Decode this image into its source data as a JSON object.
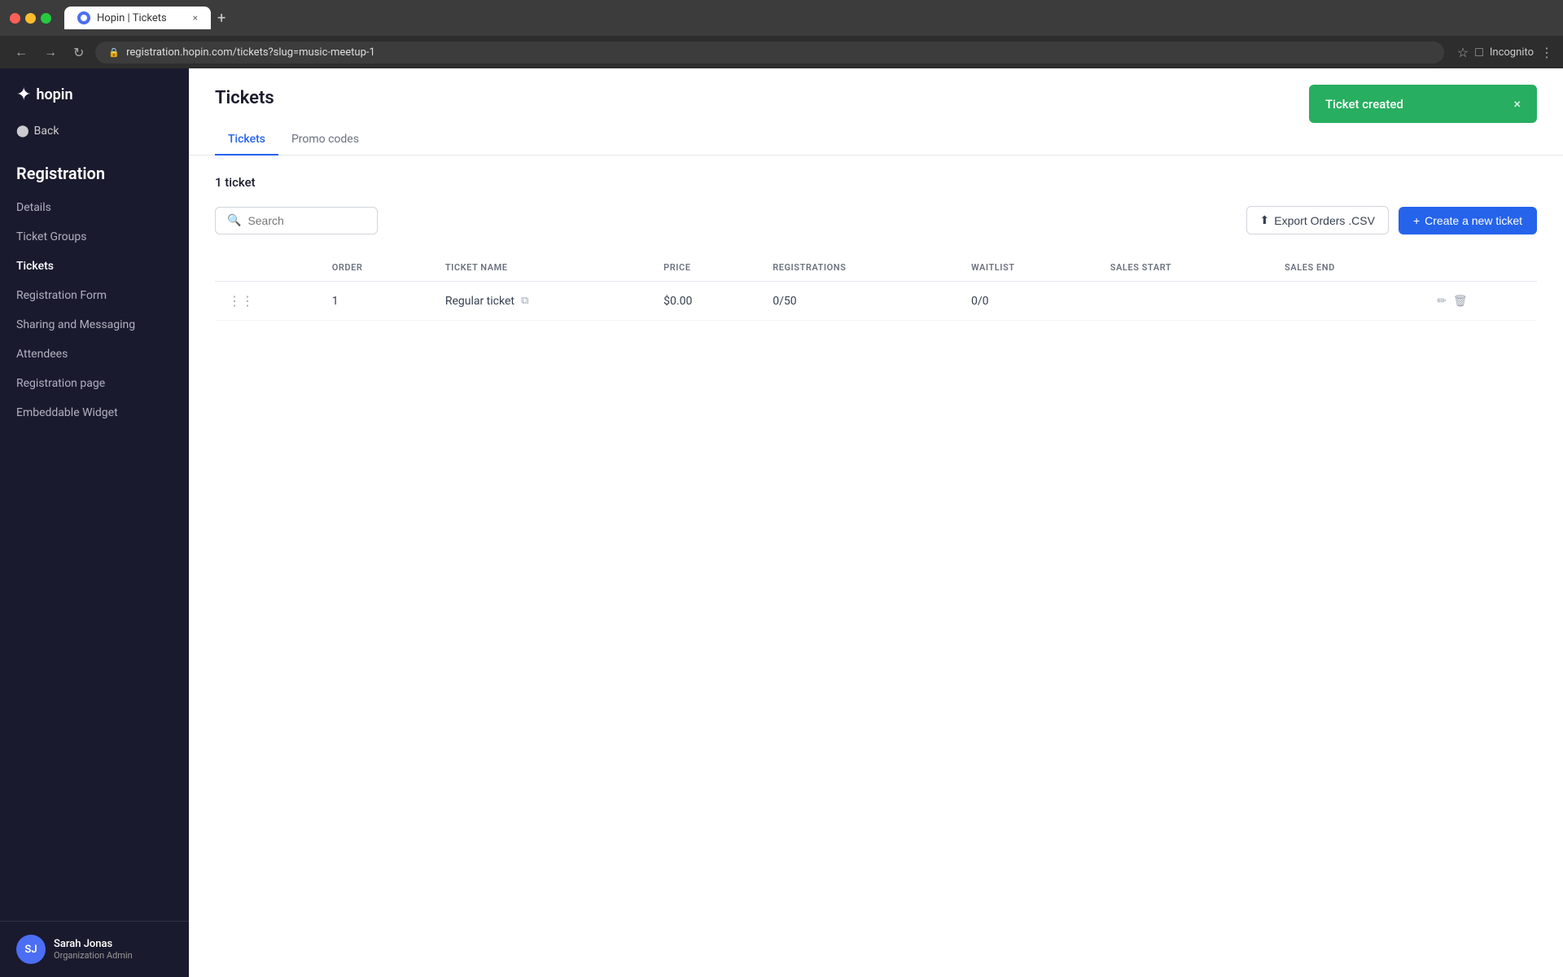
{
  "browser": {
    "tab_title": "Hopin | Tickets",
    "url": "registration.hopin.com/tickets?slug=music-meetup-1",
    "new_tab_label": "+",
    "back_label": "←",
    "forward_label": "→",
    "refresh_label": "↻",
    "profile_label": "Incognito"
  },
  "sidebar": {
    "logo_text": "hopin",
    "back_label": "Back",
    "section_title": "Registration",
    "nav_items": [
      {
        "id": "details",
        "label": "Details"
      },
      {
        "id": "ticket-groups",
        "label": "Ticket Groups"
      },
      {
        "id": "tickets",
        "label": "Tickets",
        "active": true
      },
      {
        "id": "registration-form",
        "label": "Registration Form"
      },
      {
        "id": "sharing-messaging",
        "label": "Sharing and Messaging"
      },
      {
        "id": "attendees",
        "label": "Attendees"
      },
      {
        "id": "registration-page",
        "label": "Registration page"
      },
      {
        "id": "embeddable-widget",
        "label": "Embeddable Widget"
      }
    ],
    "user": {
      "initials": "SJ",
      "name": "Sarah Jonas",
      "role": "Organization Admin"
    }
  },
  "page": {
    "title": "Tickets",
    "toast": {
      "message": "Ticket created",
      "close_label": "×"
    },
    "tabs": [
      {
        "id": "tickets",
        "label": "Tickets",
        "active": true
      },
      {
        "id": "promo-codes",
        "label": "Promo codes"
      }
    ],
    "tickets_count_label": "1 ticket",
    "search_placeholder": "Search",
    "export_btn_label": "Export Orders .CSV",
    "create_btn_label": "Create a new ticket",
    "table": {
      "columns": [
        "ORDER",
        "TICKET NAME",
        "PRICE",
        "REGISTRATIONS",
        "WAITLIST",
        "SALES START",
        "SALES END"
      ],
      "rows": [
        {
          "order": "1",
          "ticket_name": "Regular ticket",
          "price": "$0.00",
          "registrations": "0/50",
          "waitlist": "0/0",
          "sales_start": "",
          "sales_end": ""
        }
      ]
    }
  }
}
